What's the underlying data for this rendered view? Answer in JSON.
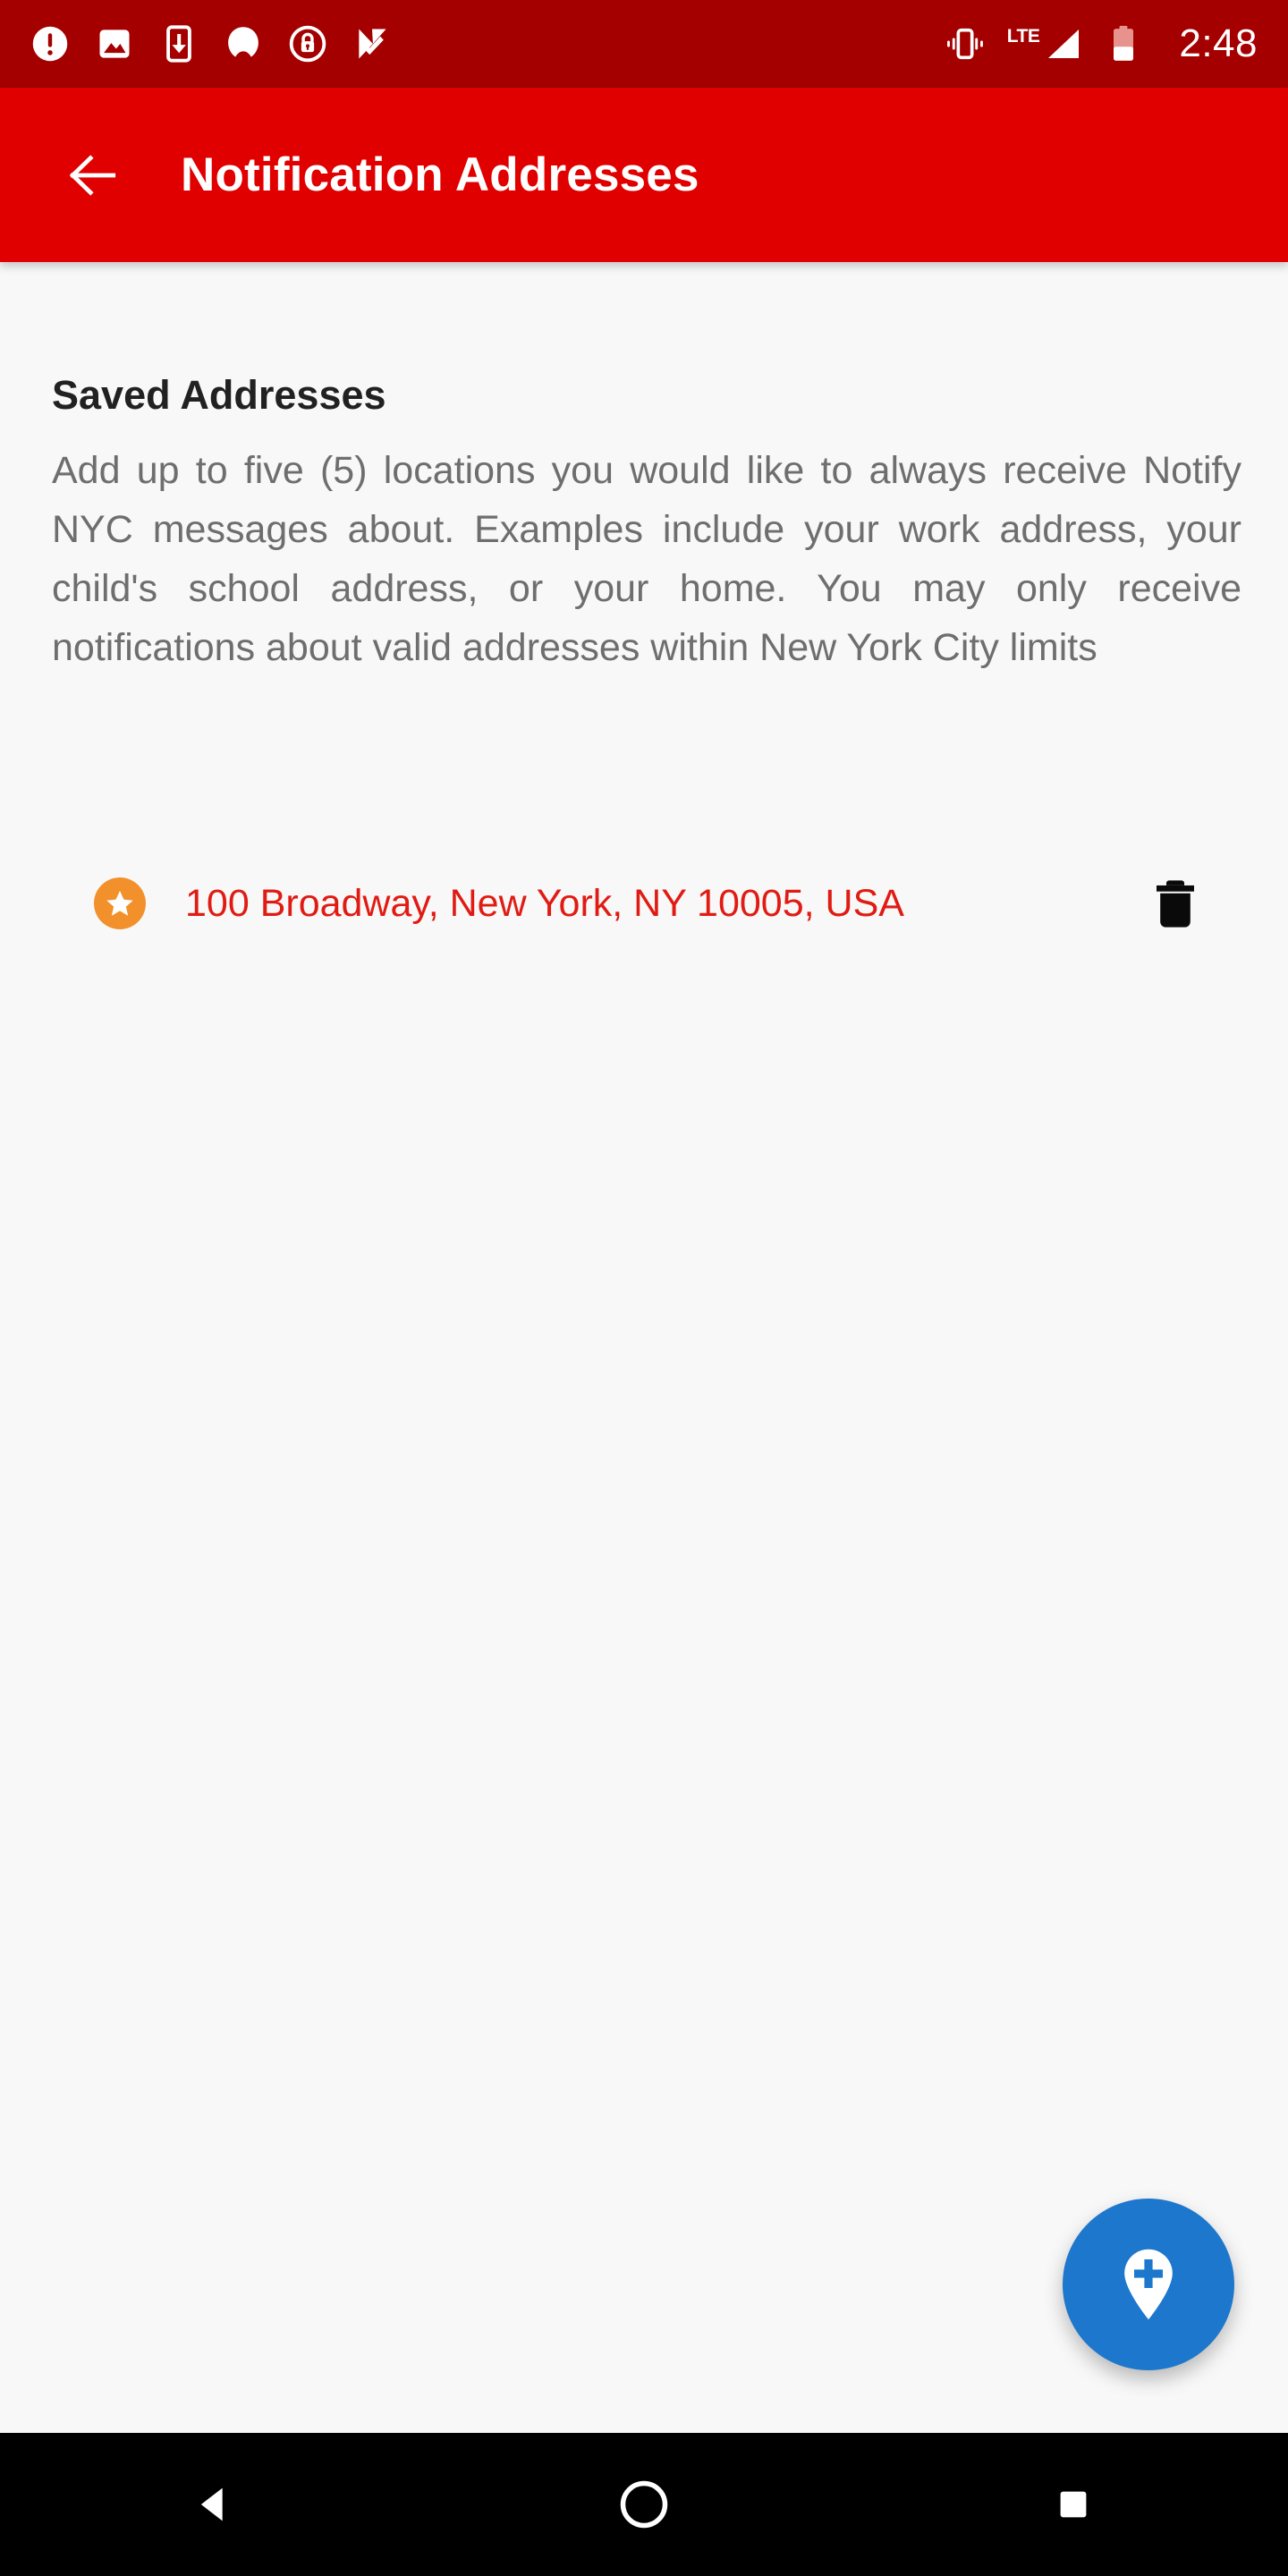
{
  "status_bar": {
    "background_color": "#a50000",
    "left_icons": [
      {
        "name": "alert-circle-icon",
        "label": "alert"
      },
      {
        "name": "photo-image-icon",
        "label": "screenshot"
      },
      {
        "name": "phone-download-icon",
        "label": "download"
      },
      {
        "name": "mask-blob-icon",
        "label": "app"
      },
      {
        "name": "lock-circle-icon",
        "label": "secure"
      },
      {
        "name": "check-chevron-icon",
        "label": "tasks"
      }
    ],
    "right_icons": [
      {
        "name": "vibrate-icon",
        "label": "vibrate"
      },
      {
        "name": "signal-cellular-icon",
        "label": "LTE"
      },
      {
        "name": "battery-low-icon",
        "label": "battery low"
      }
    ],
    "network_label": "LTE",
    "time": "2:48"
  },
  "app_bar": {
    "background_color": "#e00000",
    "title": "Notification Addresses",
    "back_label": "Back"
  },
  "main": {
    "background_color": "#f8f8f8",
    "heading": "Saved Addresses",
    "description": "Add up to five (5) locations you would like to always receive Notify NYC messages about. Examples include your work address, your child's school address, or your home. You may only receive notifications about valid addresses within New York City limits",
    "addresses": [
      {
        "text": "100 Broadway, New York, NY 10005, USA",
        "favorite": true,
        "text_color": "#e01b13",
        "badge_color": "#f2902b",
        "delete_label": "Delete"
      }
    ]
  },
  "fab": {
    "name": "add-address-button",
    "label": "Add address",
    "background_color": "#1c77cd",
    "icon": "map-pin-plus-icon"
  },
  "nav_bar": {
    "background_color": "#000000",
    "buttons": [
      {
        "name": "nav-back-button",
        "label": "Back"
      },
      {
        "name": "nav-home-button",
        "label": "Home"
      },
      {
        "name": "nav-recents-button",
        "label": "Recents"
      }
    ]
  }
}
